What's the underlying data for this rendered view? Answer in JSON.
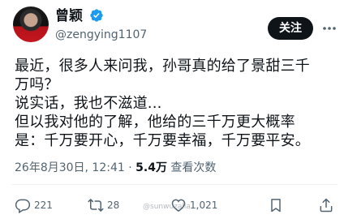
{
  "user": {
    "display_name": "曾颖",
    "handle": "@zengying1107",
    "verified": true
  },
  "follow_label": "关注",
  "tweet": {
    "text": "最近，很多人来问我，孙哥真的给了景甜三千\n万吗？\n说实话，我也不滋道...\n但以我对他的了解，他给的三千万更大概率\n是：千万要开心，千万要幸福，千万要平安。"
  },
  "meta": {
    "timestamp": "26年8月30日, 12:41 · ",
    "views_count": "5.4万",
    "views_label": " 查看次数"
  },
  "actions": {
    "reply_count": "221",
    "retweet_count": "28",
    "like_count": "1,021",
    "bookmark_count": ""
  },
  "watermark": "@sunwuzaila...",
  "icons": {
    "verified": "verified-badge-icon",
    "more": "more-icon",
    "reply": "reply-icon",
    "retweet": "retweet-icon",
    "like": "like-icon",
    "bookmark": "bookmark-icon",
    "share": "share-icon"
  },
  "colors": {
    "verified_blue": "#1d9bf0",
    "follow_button": "#0f1419",
    "secondary_text": "#536471"
  }
}
